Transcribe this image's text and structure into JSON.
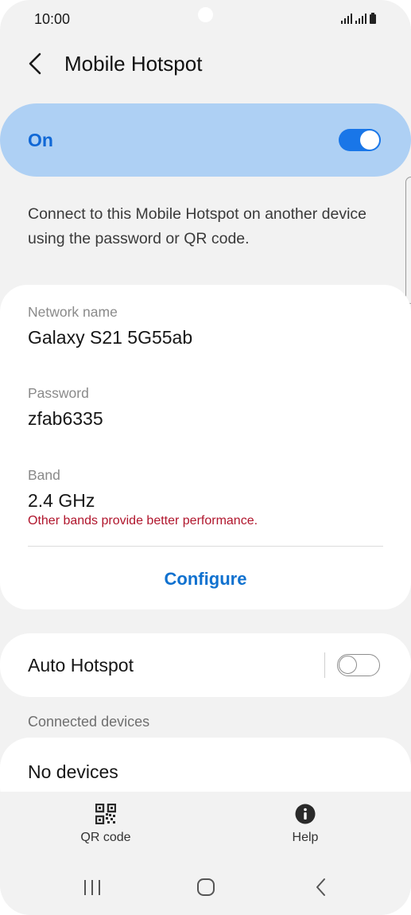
{
  "status_bar": {
    "time": "10:00"
  },
  "header": {
    "title": "Mobile Hotspot"
  },
  "master_switch": {
    "label": "On",
    "state": "on"
  },
  "description": "Connect to this Mobile Hotspot on another device using the password or QR code.",
  "network": {
    "name_label": "Network name",
    "name_value": "Galaxy S21 5G55ab",
    "password_label": "Password",
    "password_value": "zfab6335",
    "band_label": "Band",
    "band_value": "2.4 GHz",
    "band_warning": "Other bands provide better performance.",
    "configure_label": "Configure"
  },
  "auto_hotspot": {
    "label": "Auto Hotspot",
    "state": "off"
  },
  "connected_devices": {
    "header": "Connected devices",
    "empty_label": "No devices"
  },
  "bottom_actions": {
    "qr_label": "QR code",
    "help_label": "Help"
  },
  "colors": {
    "accent": "#1976e8",
    "on_card_bg": "#aed0f4",
    "warning": "#b0152c",
    "background": "#f2f2f2"
  },
  "icons": [
    "back-arrow-icon",
    "signal-icon",
    "battery-icon",
    "qr-code-icon",
    "info-icon",
    "recent-apps-icon",
    "home-icon",
    "back-nav-icon"
  ]
}
